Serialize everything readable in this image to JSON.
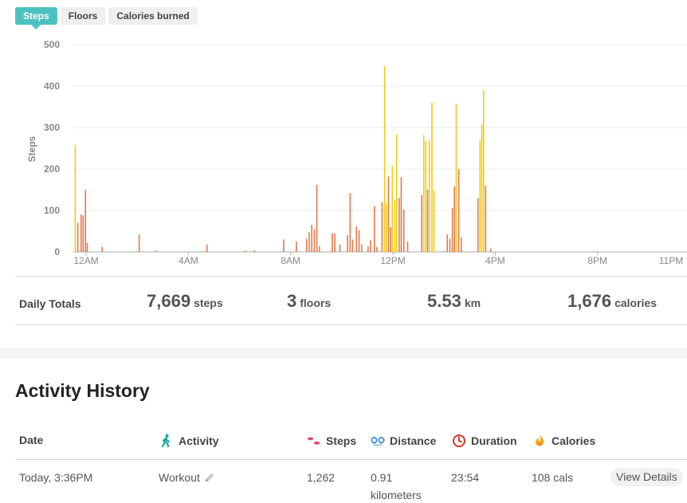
{
  "tabs": [
    {
      "label": "Steps",
      "active": true
    },
    {
      "label": "Floors",
      "active": false
    },
    {
      "label": "Calories burned",
      "active": false
    }
  ],
  "chart_data": {
    "type": "bar",
    "ylabel": "Steps",
    "ylim": [
      0,
      500
    ],
    "yticks": [
      0,
      100,
      200,
      300,
      400,
      500
    ],
    "xlim": [
      0,
      24
    ],
    "xticks": [
      {
        "v": 0.5,
        "label": "12AM"
      },
      {
        "v": 4.5,
        "label": "4AM"
      },
      {
        "v": 8.5,
        "label": "8AM"
      },
      {
        "v": 12.5,
        "label": "12PM"
      },
      {
        "v": 16.5,
        "label": "4PM"
      },
      {
        "v": 20.5,
        "label": "8PM"
      },
      {
        "v": 24.3,
        "label": "11PM"
      }
    ],
    "colors": {
      "low": "#e07b4e",
      "high": "#f0cc14",
      "grid": "#ececec",
      "axis": "#aaaaaa"
    },
    "bars": [
      {
        "t": 0.05,
        "v": 258,
        "c": "high"
      },
      {
        "t": 0.15,
        "v": 70,
        "c": "low"
      },
      {
        "t": 0.28,
        "v": 90,
        "c": "low"
      },
      {
        "t": 0.36,
        "v": 88,
        "c": "low"
      },
      {
        "t": 0.45,
        "v": 150,
        "c": "low"
      },
      {
        "t": 0.52,
        "v": 22,
        "c": "low"
      },
      {
        "t": 1.1,
        "v": 12,
        "c": "low"
      },
      {
        "t": 2.55,
        "v": 42,
        "c": "low"
      },
      {
        "t": 3.2,
        "v": 4,
        "c": "low"
      },
      {
        "t": 5.2,
        "v": 18,
        "c": "low"
      },
      {
        "t": 6.7,
        "v": 3,
        "c": "low"
      },
      {
        "t": 7.05,
        "v": 4,
        "c": "low"
      },
      {
        "t": 8.2,
        "v": 30,
        "c": "low"
      },
      {
        "t": 8.7,
        "v": 25,
        "c": "low"
      },
      {
        "t": 9.1,
        "v": 32,
        "c": "low"
      },
      {
        "t": 9.2,
        "v": 48,
        "c": "low"
      },
      {
        "t": 9.3,
        "v": 65,
        "c": "low"
      },
      {
        "t": 9.4,
        "v": 55,
        "c": "low"
      },
      {
        "t": 9.5,
        "v": 162,
        "c": "low"
      },
      {
        "t": 9.6,
        "v": 14,
        "c": "low"
      },
      {
        "t": 10.1,
        "v": 45,
        "c": "low"
      },
      {
        "t": 10.2,
        "v": 45,
        "c": "low"
      },
      {
        "t": 10.4,
        "v": 18,
        "c": "low"
      },
      {
        "t": 10.7,
        "v": 40,
        "c": "low"
      },
      {
        "t": 10.8,
        "v": 142,
        "c": "low"
      },
      {
        "t": 10.9,
        "v": 30,
        "c": "low"
      },
      {
        "t": 11.05,
        "v": 62,
        "c": "low"
      },
      {
        "t": 11.15,
        "v": 52,
        "c": "low"
      },
      {
        "t": 11.25,
        "v": 18,
        "c": "low"
      },
      {
        "t": 11.5,
        "v": 14,
        "c": "low"
      },
      {
        "t": 11.6,
        "v": 28,
        "c": "low"
      },
      {
        "t": 11.75,
        "v": 110,
        "c": "low"
      },
      {
        "t": 11.85,
        "v": 12,
        "c": "low"
      },
      {
        "t": 12.05,
        "v": 120,
        "c": "low"
      },
      {
        "t": 12.15,
        "v": 448,
        "c": "high"
      },
      {
        "t": 12.22,
        "v": 118,
        "c": "high"
      },
      {
        "t": 12.3,
        "v": 182,
        "c": "low"
      },
      {
        "t": 12.38,
        "v": 60,
        "c": "low"
      },
      {
        "t": 12.45,
        "v": 208,
        "c": "high"
      },
      {
        "t": 12.55,
        "v": 125,
        "c": "high"
      },
      {
        "t": 12.62,
        "v": 283,
        "c": "high"
      },
      {
        "t": 12.72,
        "v": 130,
        "c": "low"
      },
      {
        "t": 12.8,
        "v": 180,
        "c": "low"
      },
      {
        "t": 12.9,
        "v": 102,
        "c": "low"
      },
      {
        "t": 13.05,
        "v": 25,
        "c": "low"
      },
      {
        "t": 13.6,
        "v": 137,
        "c": "low"
      },
      {
        "t": 13.68,
        "v": 282,
        "c": "high"
      },
      {
        "t": 13.76,
        "v": 267,
        "c": "high"
      },
      {
        "t": 13.83,
        "v": 150,
        "c": "low"
      },
      {
        "t": 13.9,
        "v": 270,
        "c": "high"
      },
      {
        "t": 14.0,
        "v": 360,
        "c": "high"
      },
      {
        "t": 14.08,
        "v": 148,
        "c": "high"
      },
      {
        "t": 14.6,
        "v": 42,
        "c": "low"
      },
      {
        "t": 14.7,
        "v": 32,
        "c": "low"
      },
      {
        "t": 14.8,
        "v": 106,
        "c": "low"
      },
      {
        "t": 14.88,
        "v": 158,
        "c": "low"
      },
      {
        "t": 14.95,
        "v": 358,
        "c": "high"
      },
      {
        "t": 15.05,
        "v": 200,
        "c": "low"
      },
      {
        "t": 15.15,
        "v": 35,
        "c": "low"
      },
      {
        "t": 15.8,
        "v": 130,
        "c": "low"
      },
      {
        "t": 15.88,
        "v": 268,
        "c": "high"
      },
      {
        "t": 15.95,
        "v": 307,
        "c": "high"
      },
      {
        "t": 16.02,
        "v": 390,
        "c": "high"
      },
      {
        "t": 16.1,
        "v": 160,
        "c": "low"
      },
      {
        "t": 16.3,
        "v": 8,
        "c": "low"
      }
    ]
  },
  "totals": {
    "label": "Daily Totals",
    "items": [
      {
        "value": "7,669",
        "unit": "steps"
      },
      {
        "value": "3",
        "unit": "floors"
      },
      {
        "value": "5.53",
        "unit": "km"
      },
      {
        "value": "1,676",
        "unit": "calories"
      }
    ]
  },
  "history": {
    "title": "Activity History",
    "columns": {
      "date": "Date",
      "activity": "Activity",
      "steps": "Steps",
      "distance": "Distance",
      "duration": "Duration",
      "calories": "Calories"
    },
    "row": {
      "date": "Today, 3:36PM",
      "activity": "Workout",
      "steps": "1,262",
      "distance_value": "0.91",
      "distance_unit": "kilometers",
      "duration": "23:54",
      "calories": "108 cals",
      "details_label": "View Details"
    }
  }
}
